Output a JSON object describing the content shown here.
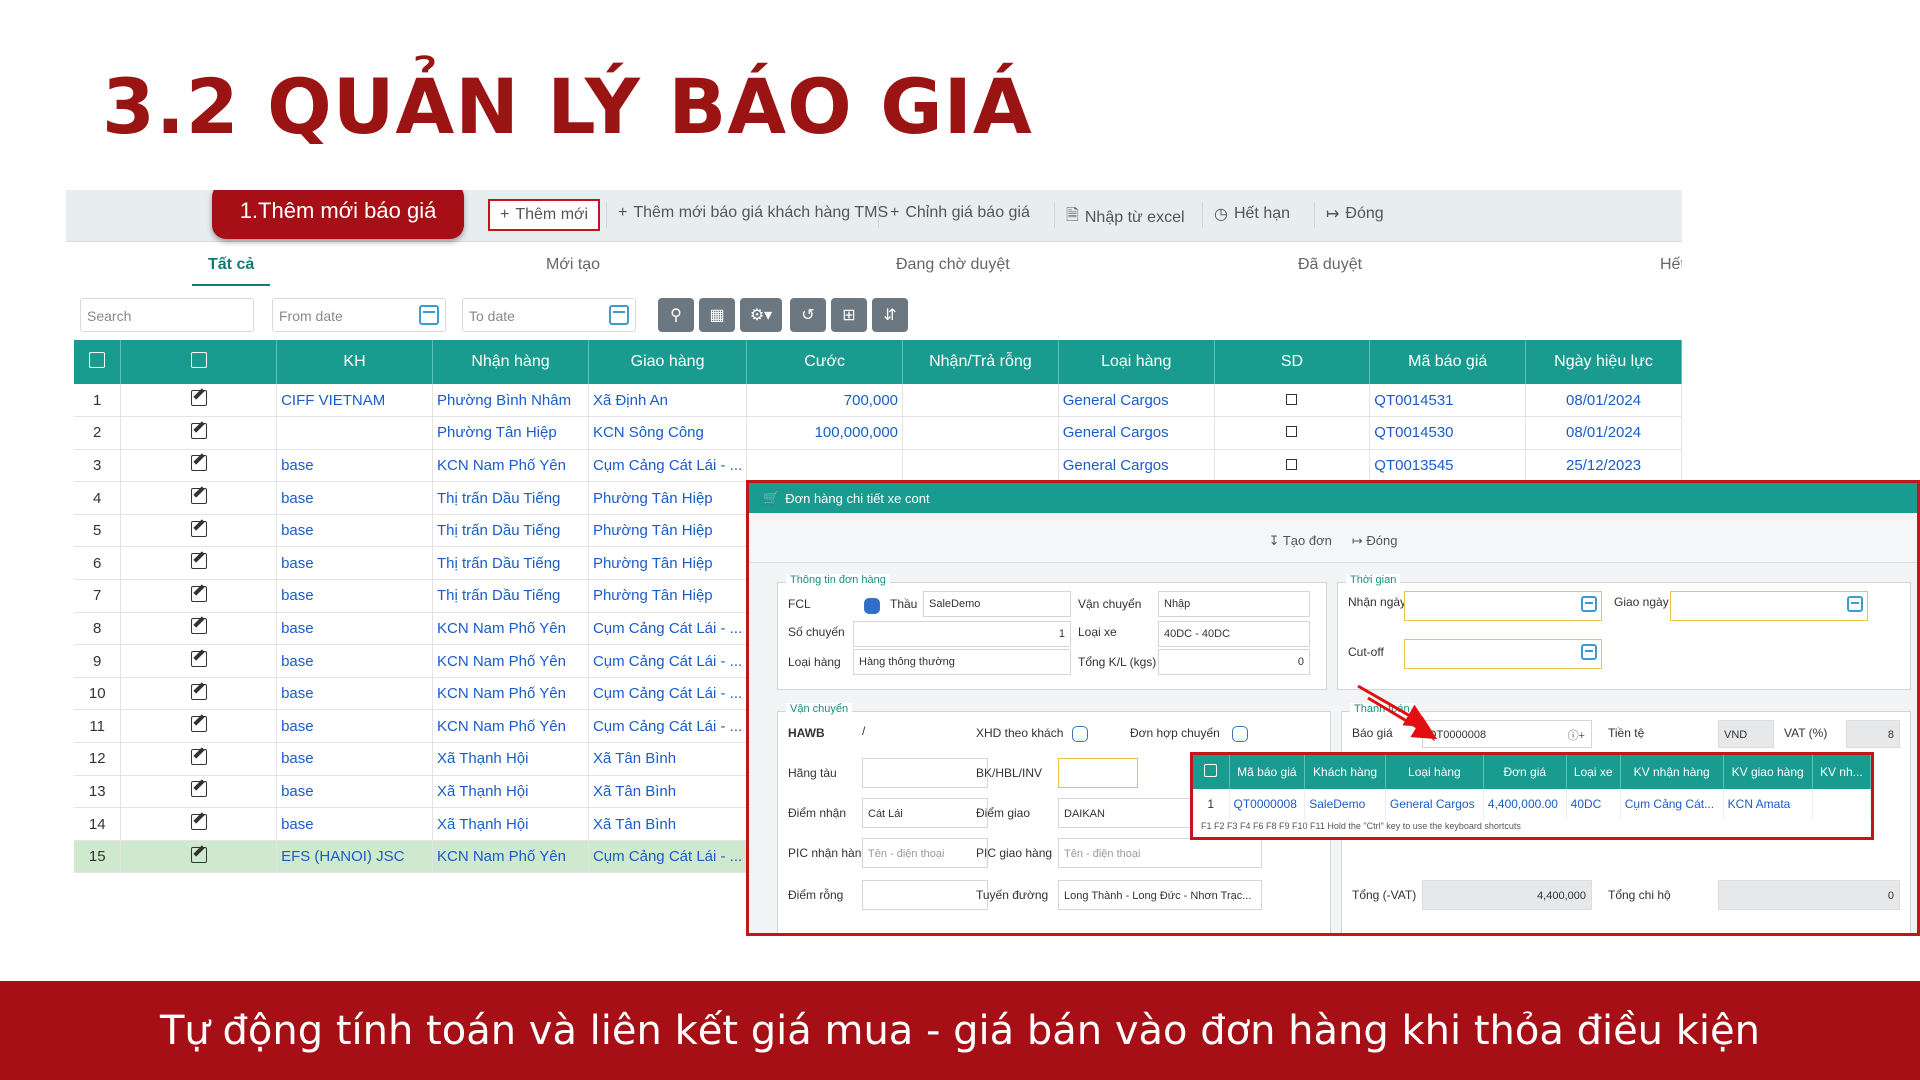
{
  "slide": {
    "title": "3.2 QUẢN LÝ BÁO GIÁ",
    "footer": "Tự động tính toán và liên kết giá mua - giá bán vào đơn hàng khi thỏa điều kiện",
    "step_badge": "1.Thêm mới báo giá",
    "accent_color": "#a50f15",
    "header_color": "#1a9b8f"
  },
  "toolbar": {
    "add_new": "Thêm mới",
    "add_tms": "Thêm mới báo giá khách hàng TMS",
    "edit_price": "Chỉnh giá báo giá",
    "import_excel": "Nhập từ excel",
    "expired": "Hết hạn",
    "close": "Đóng"
  },
  "tabs": [
    "Tất cả",
    "Mới tạo",
    "Đang chờ duyệt",
    "Đã duyệt",
    "Hết"
  ],
  "filters": {
    "search_placeholder": "Search",
    "from_placeholder": "From date",
    "to_placeholder": "To date"
  },
  "grid": {
    "columns": [
      "KH",
      "Nhận hàng",
      "Giao hàng",
      "Cước",
      "Nhận/Trả rỗng",
      "Loại hàng",
      "SD",
      "Mã báo giá",
      "Ngày hiệu lực"
    ],
    "rows": [
      {
        "no": "1",
        "kh": "CIFF VIETNAM",
        "nhan": "Phường Bình Nhâm",
        "giao": "Xã Định An",
        "cuoc": "700,000",
        "loai": "General Cargos",
        "ma": "QT0014531",
        "ngay": "08/01/2024"
      },
      {
        "no": "2",
        "kh": "",
        "nhan": "Phường Tân Hiệp",
        "giao": "KCN Sông Công",
        "cuoc": "100,000,000",
        "loai": "General Cargos",
        "ma": "QT0014530",
        "ngay": "08/01/2024"
      },
      {
        "no": "3",
        "kh": "base",
        "nhan": "KCN Nam Phố Yên",
        "giao": "Cụm Cảng Cát Lái - ...",
        "cuoc": "",
        "loai": "General Cargos",
        "ma": "QT0013545",
        "ngay": "25/12/2023"
      },
      {
        "no": "4",
        "kh": "base",
        "nhan": "Thị trấn Dầu Tiếng",
        "giao": "Phường Tân Hiệp"
      },
      {
        "no": "5",
        "kh": "base",
        "nhan": "Thị trấn Dầu Tiếng",
        "giao": "Phường Tân Hiệp"
      },
      {
        "no": "6",
        "kh": "base",
        "nhan": "Thị trấn Dầu Tiếng",
        "giao": "Phường Tân Hiệp"
      },
      {
        "no": "7",
        "kh": "base",
        "nhan": "Thị trấn Dầu Tiếng",
        "giao": "Phường Tân Hiệp"
      },
      {
        "no": "8",
        "kh": "base",
        "nhan": "KCN Nam Phố Yên",
        "giao": "Cụm Cảng Cát Lái - ..."
      },
      {
        "no": "9",
        "kh": "base",
        "nhan": "KCN Nam Phố Yên",
        "giao": "Cụm Cảng Cát Lái - ..."
      },
      {
        "no": "10",
        "kh": "base",
        "nhan": "KCN Nam Phố Yên",
        "giao": "Cụm Cảng Cát Lái - ..."
      },
      {
        "no": "11",
        "kh": "base",
        "nhan": "KCN Nam Phố Yên",
        "giao": "Cụm Cảng Cát Lái - ..."
      },
      {
        "no": "12",
        "kh": "base",
        "nhan": "Xã Thạnh Hội",
        "giao": "Xã Tân Bình"
      },
      {
        "no": "13",
        "kh": "base",
        "nhan": "Xã Thạnh Hội",
        "giao": "Xã Tân Bình"
      },
      {
        "no": "14",
        "kh": "base",
        "nhan": "Xã Thạnh Hội",
        "giao": "Xã Tân Bình"
      },
      {
        "no": "15",
        "kh": "EFS (HANOI) JSC",
        "nhan": "KCN Nam Phố Yên",
        "giao": "Cụm Cảng Cát Lái - ..."
      }
    ]
  },
  "popup": {
    "title": "Đơn hàng chi tiết xe cont",
    "create": "Tạo đơn",
    "close": "Đóng",
    "order_info": {
      "legend": "Thông tin đơn hàng",
      "fcl": "FCL",
      "thau": "Thầu",
      "thau_val": "SaleDemo",
      "van_chuyen": "Vận chuyển",
      "van_chuyen_val": "Nhập",
      "so_chuyen": "Số chuyến",
      "so_chuyen_val": "1",
      "loai_xe": "Loại xe",
      "loai_xe_val": "40DC - 40DC",
      "loai_hang": "Loại hàng",
      "loai_hang_val": "Hàng thông thường",
      "tong_kl": "Tổng K/L (kgs)",
      "tong_kl_val": "0"
    },
    "time": {
      "legend": "Thời gian",
      "nhan_ngay": "Nhận ngày",
      "giao_ngay": "Giao ngày",
      "cutoff": "Cut-off"
    },
    "transport": {
      "legend": "Vận chuyển",
      "hawb": "HAWB",
      "hawb_val": "/",
      "xhd": "XHD theo khách",
      "don_hop": "Đơn hợp chuyến",
      "hang_tau": "Hãng tàu",
      "bk": "BK/HBL/INV",
      "diem_nhan": "Điểm nhận",
      "diem_nhan_val": "Cát Lái",
      "diem_giao": "Điểm giao",
      "diem_giao_val": "DAIKAN",
      "pic_nhan": "PIC nhận hàng",
      "pic_nhan_ph": "Tên - điện thoại",
      "pic_giao": "PIC giao hàng",
      "pic_giao_ph": "Tên - điện thoại",
      "diem_rong": "Điểm rỗng",
      "tuyen": "Tuyến đường",
      "tuyen_val": "Long Thành - Long Đức - Nhơn Trạc..."
    },
    "payment": {
      "legend": "Thanh toán",
      "bao_gia": "Báo giá",
      "bao_gia_val": "QT0000008",
      "tien_te": "Tiền tệ",
      "tien_te_val": "VND",
      "vat": "VAT (%)",
      "vat_val": "8",
      "tong": "Tổng (-VAT)",
      "tong_val": "4,400,000",
      "tong_chi_ho": "Tổng chi hộ",
      "tong_chi_ho_val": "0"
    }
  },
  "quote_lookup": {
    "columns": [
      "Mã báo giá",
      "Khách hàng",
      "Loại hàng",
      "Đơn giá",
      "Loại xe",
      "KV nhận hàng",
      "KV giao hàng",
      "KV nh..."
    ],
    "row": {
      "no": "1",
      "ma": "QT0000008",
      "kh": "SaleDemo",
      "loai": "General Cargos",
      "don_gia": "4,400,000.00",
      "xe": "40DC",
      "kv_nhan": "Cụm Cảng Cát...",
      "kv_giao": "KCN Amata"
    },
    "keys": "F1    F2    F3    F4    F6    F8    F9    F10    F11      Hold the \"Ctrl\" key to use the keyboard shortcuts"
  }
}
